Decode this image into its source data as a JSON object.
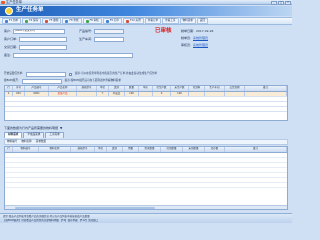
{
  "window": {
    "title": "生产任务单",
    "buttons": [
      "_",
      "□",
      "×"
    ]
  },
  "banner": {
    "heading": "生产任务单"
  },
  "toolbar": {
    "buttons": [
      {
        "label": "F1 新单"
      },
      {
        "label": "F4 保存"
      },
      {
        "label": "F5 删除"
      },
      {
        "label": "F6 查找"
      },
      {
        "label": "F8 审核"
      },
      {
        "label": "F9 打印"
      },
      {
        "label": "F12 关闭"
      },
      {
        "label": "查看订单"
      },
      {
        "label": "查看工序"
      },
      {
        "label": "物料需求"
      },
      {
        "label": "返回"
      }
    ]
  },
  "form": {
    "client_label": "客户:",
    "client_value": "(0001)  某某公司",
    "product_code_label": "产品编号:",
    "product_code_value": "",
    "order_label": "客户订单:",
    "order_value": "",
    "production_label": "生产车间:",
    "production_value": "",
    "delivery_label": "交货日期:",
    "delivery_value": "",
    "stamp": "已审核",
    "date_label": "制单日期:",
    "date_value": "2017-02-26",
    "maker_label": "制单员:",
    "maker_value": "系统管理员",
    "auditor_label": "审核员:",
    "auditor_value": "系统管理员",
    "remark_label": "备注:",
    "remark_value": ""
  },
  "options": {
    "label": "开始设置任务单:",
    "note": "提示:可以在任务单列表中直接引用生产订单,并由此自动生成生产任务单"
  },
  "bom": {
    "label": "按BOM展开:",
    "note": "提示:按BOM展开后可在下面列表中查看物料需求"
  },
  "grid1": {
    "columns": [
      "行",
      "序号",
      "产品编号",
      "产品名称",
      "规格型号",
      "单位",
      "类别",
      "数量",
      "单价",
      "已生产数",
      "未生产数",
      "已领料",
      "生产车间",
      "交货日期",
      "备注"
    ],
    "rows": [
      [
        "1",
        "001",
        "0001",
        "某某产品",
        "",
        "个",
        "半成品",
        "100",
        "",
        "0",
        "100",
        "",
        "",
        "",
        ""
      ]
    ]
  },
  "section": {
    "title": "下面的数据为行内产品所需要的物料明细",
    "tabs": [
      "材料需求",
      "半成品需求",
      "工序需求"
    ],
    "sub": [
      "物料编号",
      "物料名称",
      "需求数量"
    ]
  },
  "grid2": {
    "columns": [
      "行",
      "物料编号",
      "物料名称",
      "规格型号",
      "单位",
      "类别",
      "用量",
      "需求数量",
      "已领数量",
      "未领数量",
      "库存数",
      "备注"
    ]
  },
  "statusbar": {
    "line1": "提示:双击产品列表可查看产品的详细信息,可以在产品列表中直接修改产品数量",
    "line2": "【按BOM展开】可查看该产品所需的全部物料明细  【F4】保存单据  【F12】关闭窗口"
  }
}
